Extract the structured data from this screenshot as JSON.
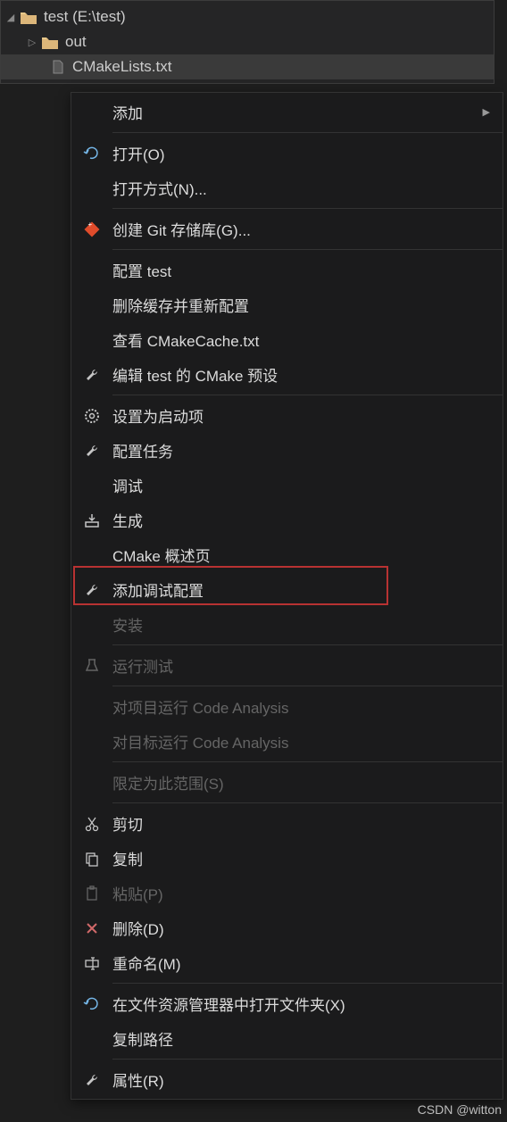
{
  "explorer": {
    "root": {
      "label": "test (E:\\test)"
    },
    "children": [
      {
        "label": "out"
      },
      {
        "label": "CMakeLists.txt"
      }
    ]
  },
  "menu": {
    "add": "添加",
    "open": "打开(O)",
    "open_with": "打开方式(N)...",
    "create_git": "创建 Git 存储库(G)...",
    "configure": "配置 test",
    "clear_cache": "删除缓存并重新配置",
    "view_cmakecache": "查看 CMakeCache.txt",
    "edit_presets": "编辑 test 的 CMake 预设",
    "set_startup": "设置为启动项",
    "configure_tasks": "配置任务",
    "debug": "调试",
    "build": "生成",
    "cmake_overview": "CMake 概述页",
    "add_debug_config": "添加调试配置",
    "install": "安装",
    "run_tests": "运行测试",
    "analysis_project": "对项目运行 Code Analysis",
    "analysis_target": "对目标运行 Code Analysis",
    "scope_to_this": "限定为此范围(S)",
    "cut": "剪切",
    "copy": "复制",
    "paste": "粘贴(P)",
    "delete": "删除(D)",
    "rename": "重命名(M)",
    "open_in_explorer": "在文件资源管理器中打开文件夹(X)",
    "copy_path": "复制路径",
    "properties": "属性(R)"
  },
  "watermark": "CSDN @witton"
}
